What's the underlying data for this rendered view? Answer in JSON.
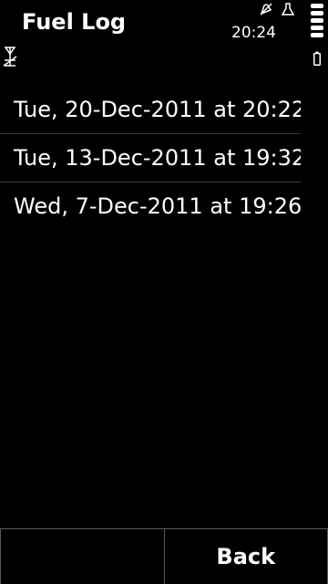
{
  "header": {
    "title": "Fuel Log",
    "clock": "20:24"
  },
  "status_icons": {
    "alarm": "alarm-icon",
    "profile": "profile-icon",
    "signal": "signal-icon",
    "battery": "battery-icon"
  },
  "log_entries": [
    {
      "label": "Tue, 20-Dec-2011 at 20:22"
    },
    {
      "label": "Tue, 13-Dec-2011 at 19:32"
    },
    {
      "label": "Wed, 7-Dec-2011 at 19:26"
    }
  ],
  "softkeys": {
    "left_label": "",
    "right_label": "Back"
  },
  "colors": {
    "background": "#000000",
    "text": "#ffffff",
    "divider": "#3a3a3a"
  }
}
